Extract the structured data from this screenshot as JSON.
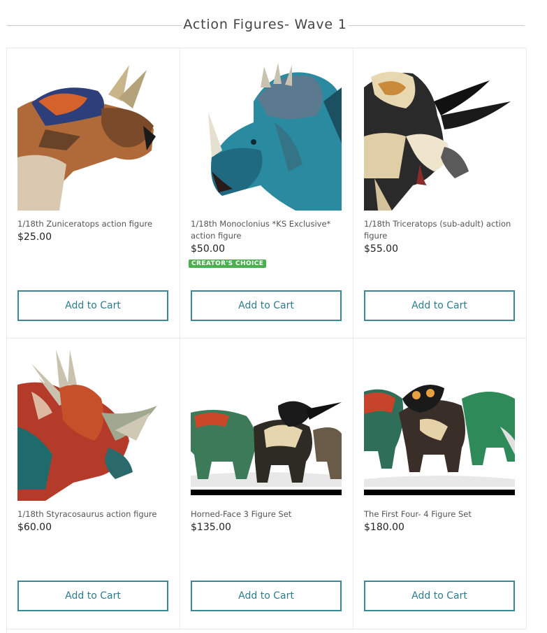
{
  "section": {
    "title": "Action Figures- Wave 1"
  },
  "products": [
    {
      "name": "1/18th Zuniceratops action figure",
      "price": "$25.00",
      "badge": "",
      "button": "Add to Cart",
      "image": "zuniceratops-photo"
    },
    {
      "name": "1/18th Monoclonius *KS Exclusive* action figure",
      "price": "$50.00",
      "badge": "CREATOR'S CHOICE",
      "button": "Add to Cart",
      "image": "monoclonius-photo"
    },
    {
      "name": "1/18th Triceratops (sub-adult) action figure",
      "price": "$55.00",
      "badge": "",
      "button": "Add to Cart",
      "image": "triceratops-photo"
    },
    {
      "name": "1/18th Styracosaurus action figure",
      "price": "$60.00",
      "badge": "",
      "button": "Add to Cart",
      "image": "styracosaurus-photo"
    },
    {
      "name": "Horned-Face 3 Figure Set",
      "price": "$135.00",
      "badge": "",
      "button": "Add to Cart",
      "image": "three-figure-set-photo"
    },
    {
      "name": "The First Four- 4 Figure Set",
      "price": "$180.00",
      "badge": "",
      "button": "Add to Cart",
      "image": "four-figure-set-photo"
    }
  ],
  "colors": {
    "button_border": "#3a8996",
    "button_text": "#2d7d8c",
    "badge_bg": "#4caf50"
  }
}
